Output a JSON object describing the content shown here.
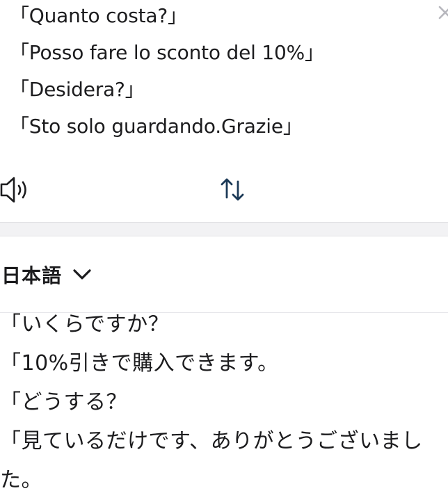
{
  "source": {
    "lines": [
      "「Quanto costa?」",
      "「Posso fare lo sconto del 10%」",
      "「Desidera?」",
      "「Sto solo guardando.Grazie」"
    ]
  },
  "controls": {
    "speaker_icon": "speaker-icon",
    "swap_icon": "swap-arrows-icon",
    "close_icon": "close-icon"
  },
  "target": {
    "language": "日本語",
    "lines": [
      "「いくらですか？",
      "「10%引きで購入できます。",
      "「どうする？",
      "「見ているだけです、ありがとうございました。"
    ]
  },
  "colors": {
    "text": "#1c1c1e",
    "divider_band": "#f2f2f4"
  }
}
